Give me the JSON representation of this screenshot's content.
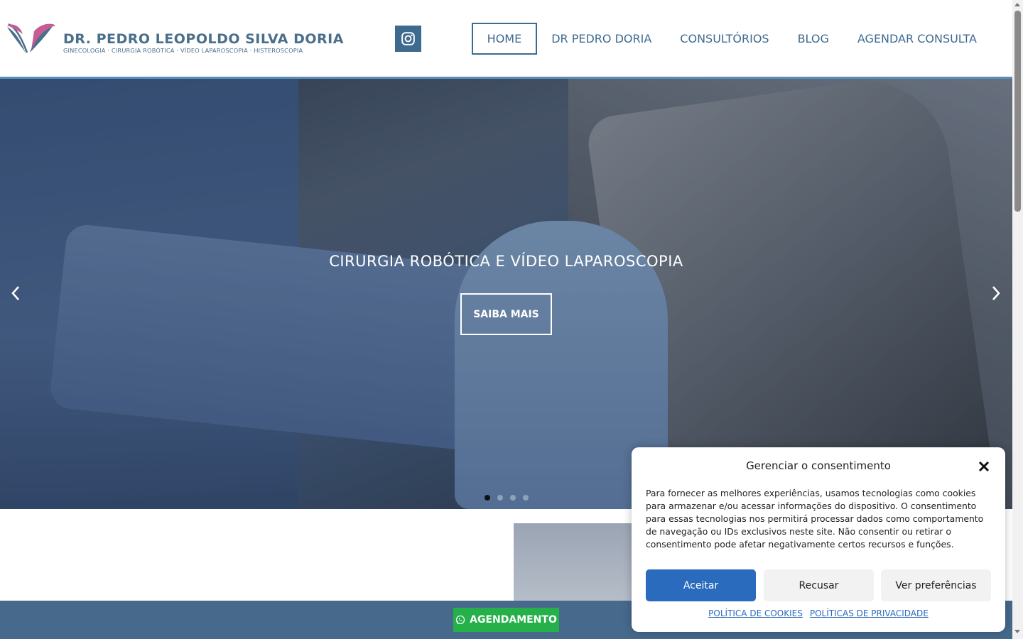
{
  "header": {
    "logo_name": "DR. PEDRO LEOPOLDO SILVA DORIA",
    "logo_subtitle": "GINECOLOGIA · CIRURGIA ROBÓTICA · VÍDEO LAPAROSCOPIA · HISTEROSCOPIA",
    "social_icon": "instagram-icon",
    "nav": [
      {
        "label": "HOME",
        "active": true
      },
      {
        "label": "DR PEDRO DORIA",
        "active": false
      },
      {
        "label": "CONSULTÓRIOS",
        "active": false
      },
      {
        "label": "BLOG",
        "active": false
      },
      {
        "label": "AGENDAR CONSULTA",
        "active": false
      }
    ]
  },
  "hero": {
    "title": "CIRURGIA ROBÓTICA E VÍDEO LAPAROSCOPIA",
    "button": "SAIBA MAIS",
    "slide_count": 4,
    "active_slide": 1,
    "prev_icon": "chevron-left-icon",
    "next_icon": "chevron-right-icon"
  },
  "bottom_bar": {
    "button": "AGENDAMENTO",
    "icon": "whatsapp-icon"
  },
  "consent": {
    "title": "Gerenciar o consentimento",
    "text": "Para fornecer as melhores experiências, usamos tecnologias como cookies para armazenar e/ou acessar informações do dispositivo. O consentimento para essas tecnologias nos permitirá processar dados como comportamento de navegação ou IDs exclusivos neste site. Não consentir ou retirar o consentimento pode afetar negativamente certos recursos e funções.",
    "accept": "Aceitar",
    "deny": "Recusar",
    "preferences": "Ver preferências",
    "link_cookies": "POLÍTICA DE COOKIES",
    "link_privacy": "POLÍTICAS DE PRIVACIDADE"
  },
  "colors": {
    "brand": "#3d6a8f",
    "accent_bar": "#46698c",
    "whatsapp_green": "#25b04a",
    "consent_blue": "#2b6bbd"
  }
}
